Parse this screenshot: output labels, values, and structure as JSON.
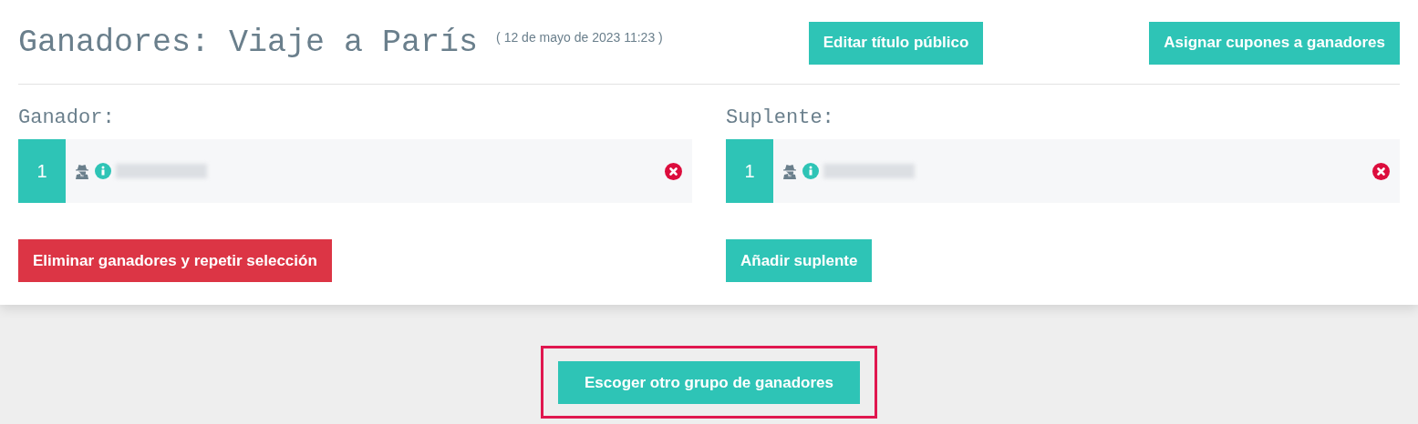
{
  "header": {
    "title": "Ganadores: Viaje a París",
    "date": "( 12 de mayo de 2023 11:23 )",
    "buttons": [
      "Editar título público",
      "Asignar cupones a ganadores"
    ]
  },
  "columns": [
    {
      "label": "Ganador:",
      "entries": [
        {
          "number": "1"
        }
      ],
      "button": {
        "label": "Eliminar ganadores y repetir selección",
        "kind": "danger"
      }
    },
    {
      "label": "Suplente:",
      "entries": [
        {
          "number": "1"
        }
      ],
      "button": {
        "label": "Añadir suplente",
        "kind": "primary"
      }
    }
  ],
  "footer": {
    "button": "Escoger otro grupo de ganadores",
    "highlighted": true
  }
}
